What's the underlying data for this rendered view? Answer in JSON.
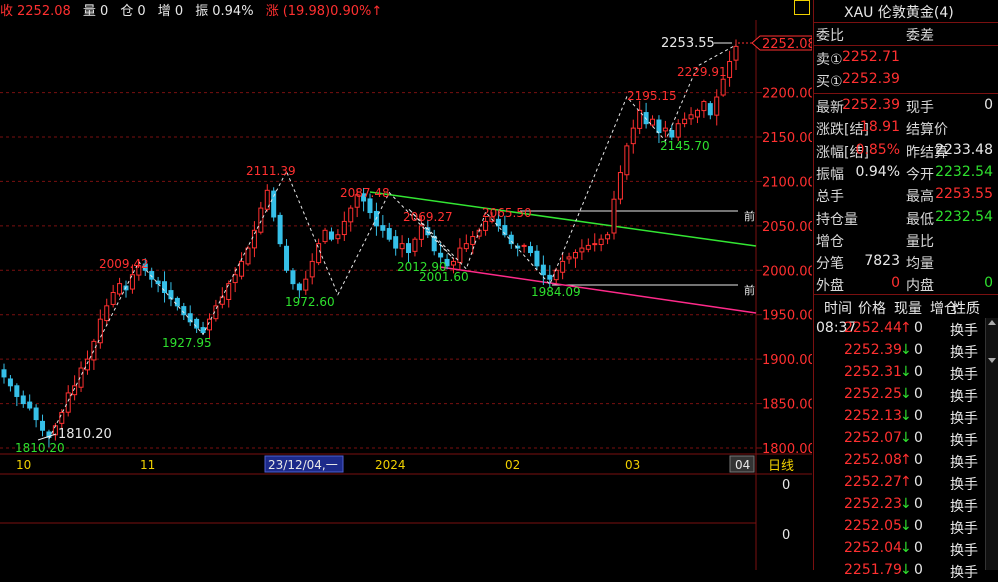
{
  "colors": {
    "up": "#ff3030",
    "down": "#2ee02e",
    "grid": "#7a1010",
    "ma": "#ffffff",
    "trend_green": "#33e633",
    "trend_pink": "#ff2a8a"
  },
  "topbar": {
    "close_label": "收",
    "close_value": "2252.08",
    "vol_label": "量",
    "vol_value": "0",
    "pos_label": "仓",
    "pos_value": "0",
    "inc_label": "增",
    "inc_value": "0",
    "amp_label": "振",
    "amp_value": "0.94%",
    "chg_label": "涨",
    "chg_value": "(19.98)0.90%↑"
  },
  "price_axis": {
    "ticks": [
      "2200.00",
      "2150.00",
      "2100.00",
      "2050.00",
      "2000.00",
      "1950.00",
      "1900.00",
      "1850.00",
      "1800.00"
    ],
    "current": "2252.08",
    "lower_ticks": [
      "0",
      "0"
    ]
  },
  "time_axis": {
    "labels": [
      "10",
      "11",
      "23/12/04,一",
      "2024",
      "02",
      "03",
      "04"
    ],
    "period": "日线"
  },
  "annotations": [
    {
      "text": "2253.55",
      "color": "white"
    },
    {
      "text": "2229.91",
      "color": "red"
    },
    {
      "text": "2195.15",
      "color": "red"
    },
    {
      "text": "2145.70",
      "color": "green"
    },
    {
      "text": "2111.39",
      "color": "red"
    },
    {
      "text": "2087.48",
      "color": "red"
    },
    {
      "text": "2069.27",
      "color": "red"
    },
    {
      "text": "2065.50",
      "color": "red"
    },
    {
      "text": "2009.42",
      "color": "red"
    },
    {
      "text": "2012.90",
      "color": "green"
    },
    {
      "text": "2001.60",
      "color": "green"
    },
    {
      "text": "1984.09",
      "color": "green"
    },
    {
      "text": "1972.60",
      "color": "green"
    },
    {
      "text": "1927.95",
      "color": "green"
    },
    {
      "text": "1810.20",
      "color": "white"
    },
    {
      "text": "1810.20",
      "color": "green"
    }
  ],
  "line_labels": [
    "前",
    "前"
  ],
  "chart_data": {
    "type": "candlestick",
    "ylim": [
      1800,
      2260
    ],
    "x_labels": [
      "10",
      "11",
      "23/12/04,一",
      "2024",
      "02",
      "03",
      "04"
    ],
    "swing_points": [
      {
        "label": "1810.20",
        "y": 1810.2
      },
      {
        "label": "2009.42",
        "y": 2009.42
      },
      {
        "label": "1927.95",
        "y": 1927.95
      },
      {
        "label": "2111.39",
        "y": 2111.39
      },
      {
        "label": "1972.60",
        "y": 1972.6
      },
      {
        "label": "2087.48",
        "y": 2087.48
      },
      {
        "label": "2012.90",
        "y": 2012.9
      },
      {
        "label": "2069.27",
        "y": 2069.27
      },
      {
        "label": "2001.60",
        "y": 2001.6
      },
      {
        "label": "2065.50",
        "y": 2065.5
      },
      {
        "label": "1984.09",
        "y": 1984.09
      },
      {
        "label": "2195.15",
        "y": 2195.15
      },
      {
        "label": "2145.70",
        "y": 2145.7
      },
      {
        "label": "2229.91",
        "y": 2229.91
      },
      {
        "label": "2253.55",
        "y": 2253.55
      }
    ],
    "closes": [
      1880,
      1870,
      1858,
      1850,
      1845,
      1832,
      1820,
      1812,
      1825,
      1840,
      1862,
      1870,
      1890,
      1900,
      1920,
      1945,
      1960,
      1975,
      1985,
      1978,
      1995,
      2005,
      2000,
      1990,
      1985,
      1975,
      1968,
      1960,
      1950,
      1942,
      1935,
      1930,
      1945,
      1960,
      1970,
      1985,
      1995,
      2010,
      2025,
      2045,
      2070,
      2090,
      2060,
      2030,
      2000,
      1985,
      1978,
      1990,
      2010,
      2030,
      2045,
      2035,
      2040,
      2055,
      2070,
      2085,
      2078,
      2065,
      2050,
      2045,
      2035,
      2025,
      2030,
      2020,
      2035,
      2050,
      2040,
      2022,
      2015,
      2005,
      2010,
      2025,
      2030,
      2038,
      2045,
      2055,
      2060,
      2050,
      2040,
      2030,
      2025,
      2028,
      2020,
      2005,
      1995,
      1990,
      2000,
      2010,
      2015,
      2020,
      2025,
      2028,
      2030,
      2035,
      2040,
      2080,
      2110,
      2140,
      2160,
      2180,
      2165,
      2170,
      2155,
      2160,
      2150,
      2165,
      2170,
      2175,
      2180,
      2190,
      2175,
      2195,
      2215,
      2235,
      2252
    ]
  },
  "quote": {
    "title": "XAU 伦敦黄金(4)",
    "header_left": "委比",
    "header_right": "委差",
    "sell_label": "卖①",
    "sell_value": "2252.71",
    "buy_label": "买①",
    "buy_value": "2252.39",
    "rows": [
      {
        "l": "最新",
        "lv": "2252.39",
        "lc": "red",
        "r": "现手",
        "rv": "0",
        "rc": "white"
      },
      {
        "l": "涨跌[结]",
        "lv": "18.91",
        "lc": "red",
        "r": "结算价",
        "rv": "",
        "rc": "white"
      },
      {
        "l": "涨幅[结]",
        "lv": "0.85%",
        "lc": "red",
        "r": "昨结算",
        "rv": "2233.48",
        "rc": "white"
      },
      {
        "l": "振幅",
        "lv": "0.94%",
        "lc": "white",
        "r": "今开",
        "rv": "2232.54",
        "rc": "green"
      },
      {
        "l": "总手",
        "lv": "",
        "lc": "white",
        "r": "最高",
        "rv": "2253.55",
        "rc": "red"
      },
      {
        "l": "持仓量",
        "lv": "",
        "lc": "white",
        "r": "最低",
        "rv": "2232.54",
        "rc": "green"
      },
      {
        "l": "增仓",
        "lv": "",
        "lc": "white",
        "r": "量比",
        "rv": "",
        "rc": "white"
      },
      {
        "l": "分笔",
        "lv": "7823",
        "lc": "white",
        "r": "均量",
        "rv": "",
        "rc": "white"
      },
      {
        "l": "外盘",
        "lv": "0",
        "lc": "red",
        "r": "内盘",
        "rv": "0",
        "rc": "green"
      }
    ]
  },
  "ticks": {
    "headers": [
      "时间",
      "价格",
      "现量",
      "增仓",
      "性质"
    ],
    "first_time": "08:37",
    "rows": [
      {
        "price": "2252.44",
        "arrow": "↑",
        "vol": "0",
        "kind": "换手"
      },
      {
        "price": "2252.39",
        "arrow": "↓",
        "vol": "0",
        "kind": "换手"
      },
      {
        "price": "2252.31",
        "arrow": "↓",
        "vol": "0",
        "kind": "换手"
      },
      {
        "price": "2252.25",
        "arrow": "↓",
        "vol": "0",
        "kind": "换手"
      },
      {
        "price": "2252.13",
        "arrow": "↓",
        "vol": "0",
        "kind": "换手"
      },
      {
        "price": "2252.07",
        "arrow": "↓",
        "vol": "0",
        "kind": "换手"
      },
      {
        "price": "2252.08",
        "arrow": "↑",
        "vol": "0",
        "kind": "换手"
      },
      {
        "price": "2252.27",
        "arrow": "↑",
        "vol": "0",
        "kind": "换手"
      },
      {
        "price": "2252.23",
        "arrow": "↓",
        "vol": "0",
        "kind": "换手"
      },
      {
        "price": "2252.05",
        "arrow": "↓",
        "vol": "0",
        "kind": "换手"
      },
      {
        "price": "2252.04",
        "arrow": "↓",
        "vol": "0",
        "kind": "换手"
      },
      {
        "price": "2251.79",
        "arrow": "↓",
        "vol": "0",
        "kind": "换手"
      }
    ]
  }
}
